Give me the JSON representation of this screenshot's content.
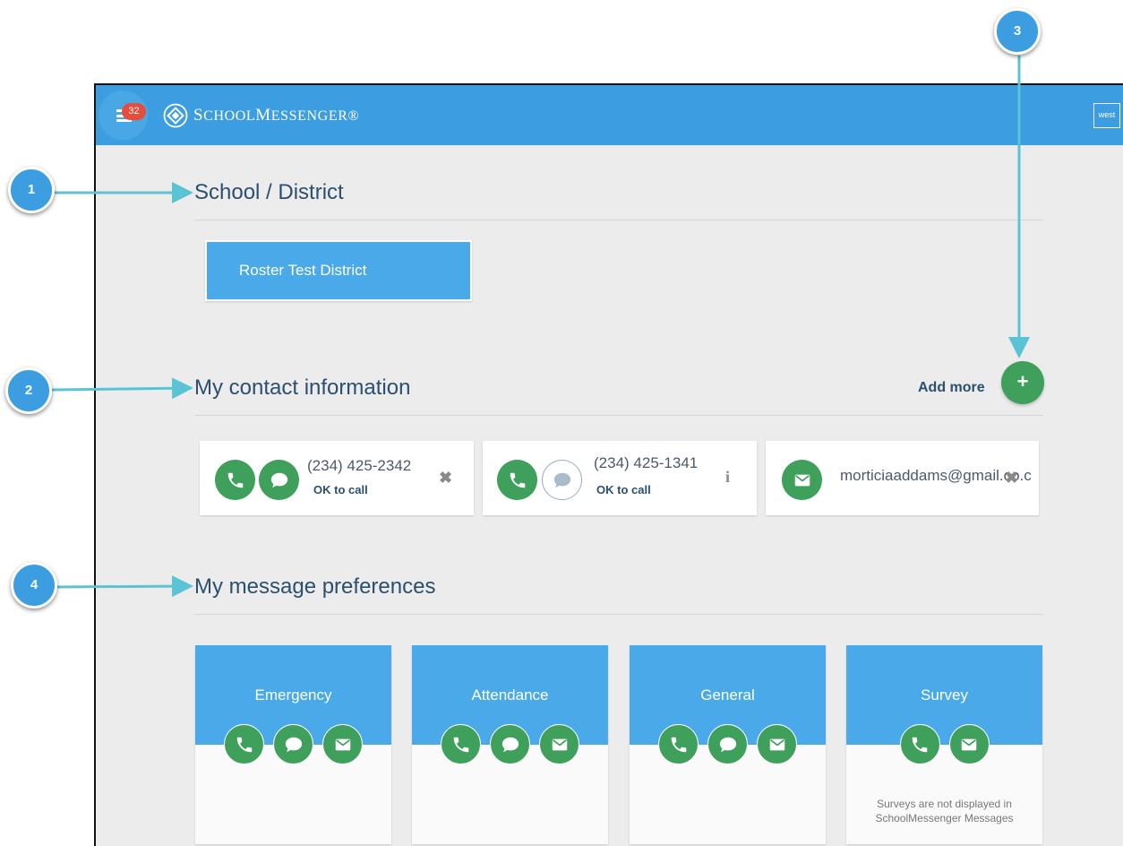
{
  "header": {
    "notification_count": "32",
    "logo_text_first": "S",
    "logo_text_rest": "CHOOL",
    "logo_text_second_first": "M",
    "logo_text_second_rest": "ESSENGER",
    "logo_reg": "®",
    "district_logo_text": "west",
    "brand_color": "#3c9de0"
  },
  "school_section": {
    "title": "School / District",
    "district_name": "Roster Test District"
  },
  "contact_section": {
    "title": "My contact information",
    "add_more_label": "Add more",
    "add_button_symbol": "+",
    "contacts": [
      {
        "type": "phone",
        "number": "(234) 425-2342",
        "status": "OK to call",
        "icons": [
          "phone-icon",
          "sms-icon"
        ],
        "sms_enabled": true,
        "action_icon": "remove-icon",
        "action_symbol": "✖"
      },
      {
        "type": "phone",
        "number": "(234) 425-1341",
        "status": "OK to call",
        "icons": [
          "phone-icon",
          "sms-icon"
        ],
        "sms_enabled": false,
        "action_icon": "info-icon",
        "action_symbol": "i"
      },
      {
        "type": "email",
        "address": "morticiaaddams@gmail.co.c",
        "icons": [
          "email-icon"
        ],
        "action_icon": "remove-icon",
        "action_symbol": "✖"
      }
    ]
  },
  "preferences_section": {
    "title": "My message preferences",
    "categories": [
      {
        "name": "Emergency",
        "icons": [
          "phone-icon",
          "sms-icon",
          "email-icon"
        ],
        "note": ""
      },
      {
        "name": "Attendance",
        "icons": [
          "phone-icon",
          "sms-icon",
          "email-icon"
        ],
        "note": ""
      },
      {
        "name": "General",
        "icons": [
          "phone-icon",
          "sms-icon",
          "email-icon"
        ],
        "note": ""
      },
      {
        "name": "Survey",
        "icons": [
          "phone-icon",
          "email-icon"
        ],
        "note_line1": "Surveys are not displayed in",
        "note_line2": "SchoolMessenger Messages"
      }
    ]
  },
  "callouts": [
    "1",
    "2",
    "3",
    "4"
  ],
  "colors": {
    "accent_green": "#3ea05a",
    "card_blue": "#4aa9e8",
    "callout_arrow": "#5bc4d4"
  }
}
